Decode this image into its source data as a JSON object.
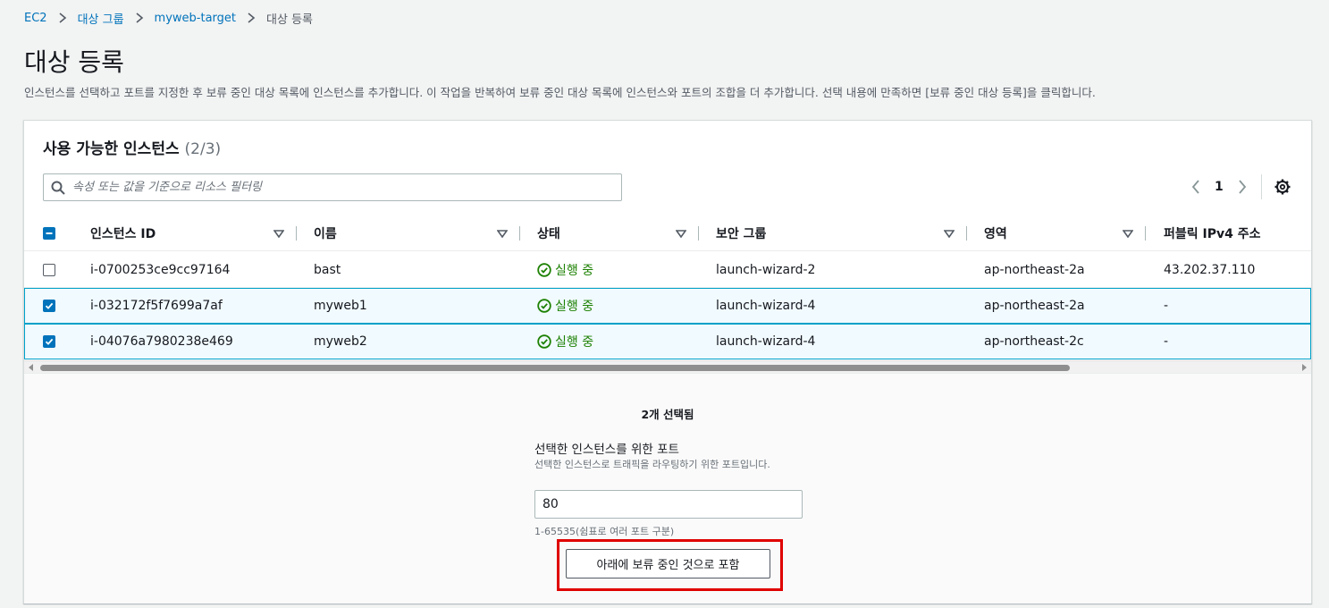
{
  "breadcrumb": {
    "items": [
      "EC2",
      "대상 그룹",
      "myweb-target"
    ],
    "current": "대상 등록"
  },
  "page": {
    "title": "대상 등록",
    "description": "인스턴스를 선택하고 포트를 지정한 후 보류 중인 대상 목록에 인스턴스를 추가합니다. 이 작업을 반복하여 보류 중인 대상 목록에 인스턴스와 포트의 조합을 더 추가합니다. 선택 내용에 만족하면 [보류 중인 대상 등록]을 클릭합니다."
  },
  "instances_panel": {
    "heading": "사용 가능한 인스턴스",
    "count": "(2/3)",
    "search_placeholder": "속성 또는 값을 기준으로 리소스 필터링",
    "page_number": "1",
    "columns": [
      "인스턴스 ID",
      "이름",
      "상태",
      "보안 그룹",
      "영역",
      "퍼블릭 IPv4 주소"
    ],
    "rows": [
      {
        "id": "i-0700253ce9cc97164",
        "name": "bast",
        "status": "실행 중",
        "sg": "launch-wizard-2",
        "zone": "ap-northeast-2a",
        "ip": "43.202.37.110",
        "selected": false
      },
      {
        "id": "i-032172f5f7699a7af",
        "name": "myweb1",
        "status": "실행 중",
        "sg": "launch-wizard-4",
        "zone": "ap-northeast-2a",
        "ip": "-",
        "selected": true
      },
      {
        "id": "i-04076a7980238e469",
        "name": "myweb2",
        "status": "실행 중",
        "sg": "launch-wizard-4",
        "zone": "ap-northeast-2c",
        "ip": "-",
        "selected": true
      }
    ]
  },
  "selection": {
    "count_text": "2개 선택됨",
    "port_label": "선택한 인스턴스를 위한 포트",
    "port_description": "선택한 인스턴스로 트래픽을 라우팅하기 위한 포트입니다.",
    "port_value": "80",
    "port_hint": "1-65535(쉼표로 여러 포트 구분)",
    "include_button": "아래에 보류 중인 것으로 포함"
  },
  "colors": {
    "link": "#0073bb",
    "running": "#1d8102",
    "selected_row_bg": "#f1faff",
    "selected_row_border": "#00a1c9",
    "highlight": "#e00000"
  }
}
